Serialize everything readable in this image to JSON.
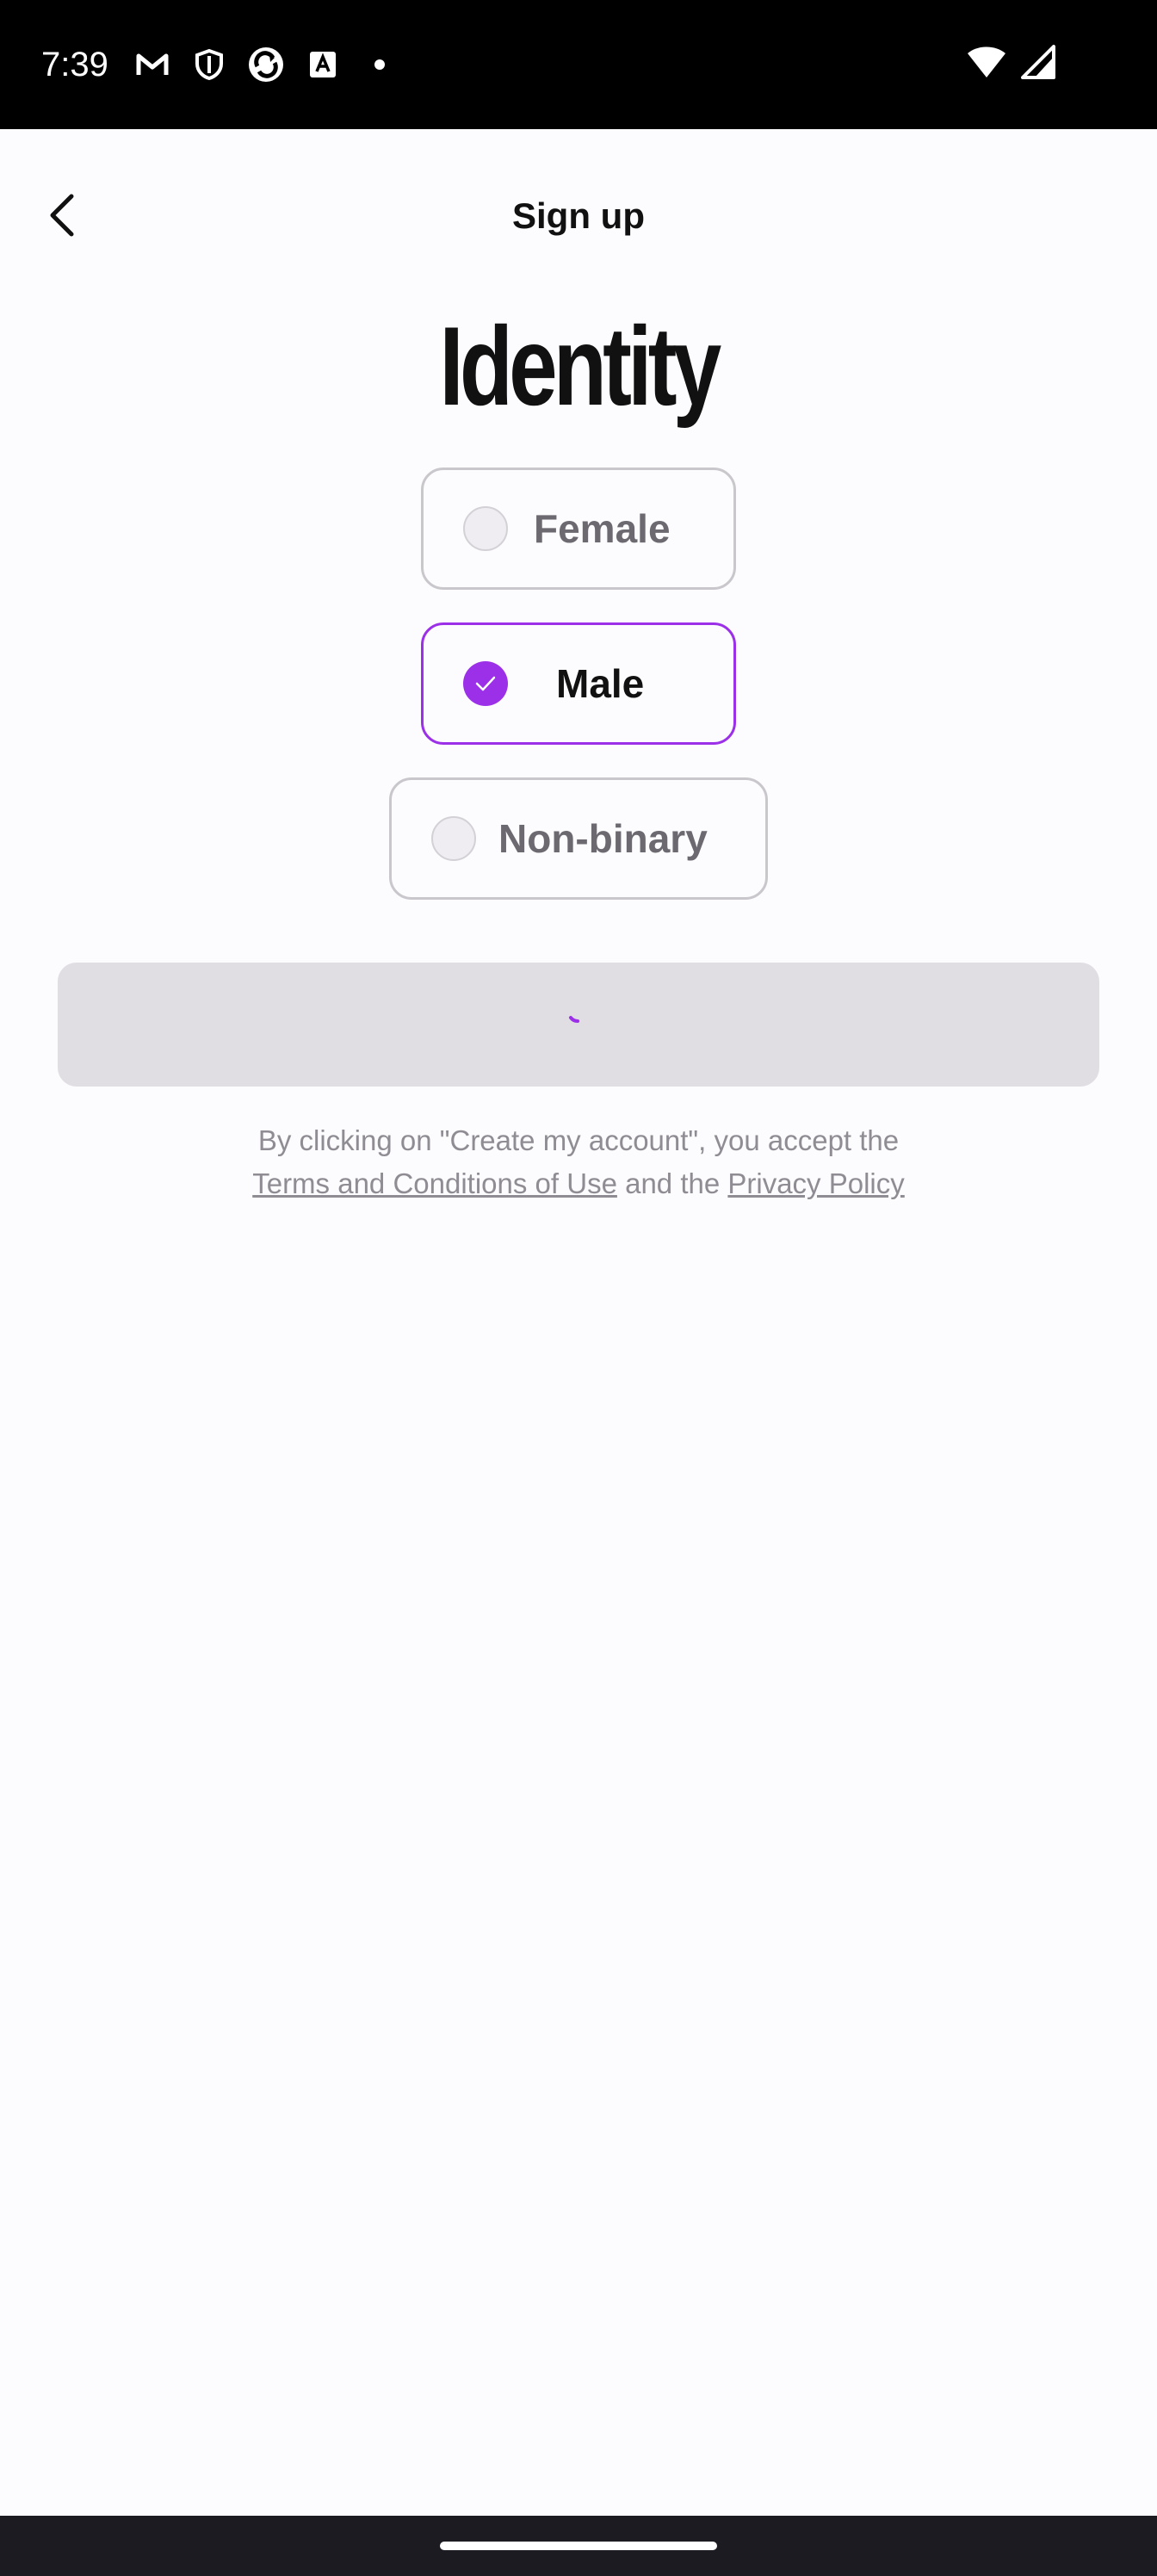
{
  "status_bar": {
    "time": "7:39",
    "icons": [
      "gmail-icon",
      "shield-icon",
      "sync-app-icon",
      "font-app-icon",
      "dot-icon"
    ],
    "right_icons": [
      "wifi-icon",
      "signal-icon"
    ]
  },
  "header": {
    "title": "Sign up",
    "back_icon": "chevron-left-icon"
  },
  "page": {
    "heading": "Identity"
  },
  "options": [
    {
      "label": "Female",
      "selected": false
    },
    {
      "label": "Male",
      "selected": true
    },
    {
      "label": "Non-binary",
      "selected": false
    }
  ],
  "create_button": {
    "state": "loading"
  },
  "legal": {
    "line1": "By clicking on \"Create my account\", you accept the",
    "terms_link": "Terms and Conditions of Use",
    "and_the": "and the",
    "privacy_link": "Privacy Policy"
  },
  "colors": {
    "accent": "#9b30e8",
    "background": "#fcfbfd",
    "button_disabled": "#e0dde3",
    "status_bar": "#000000",
    "nav_bar": "#1d1b22"
  }
}
